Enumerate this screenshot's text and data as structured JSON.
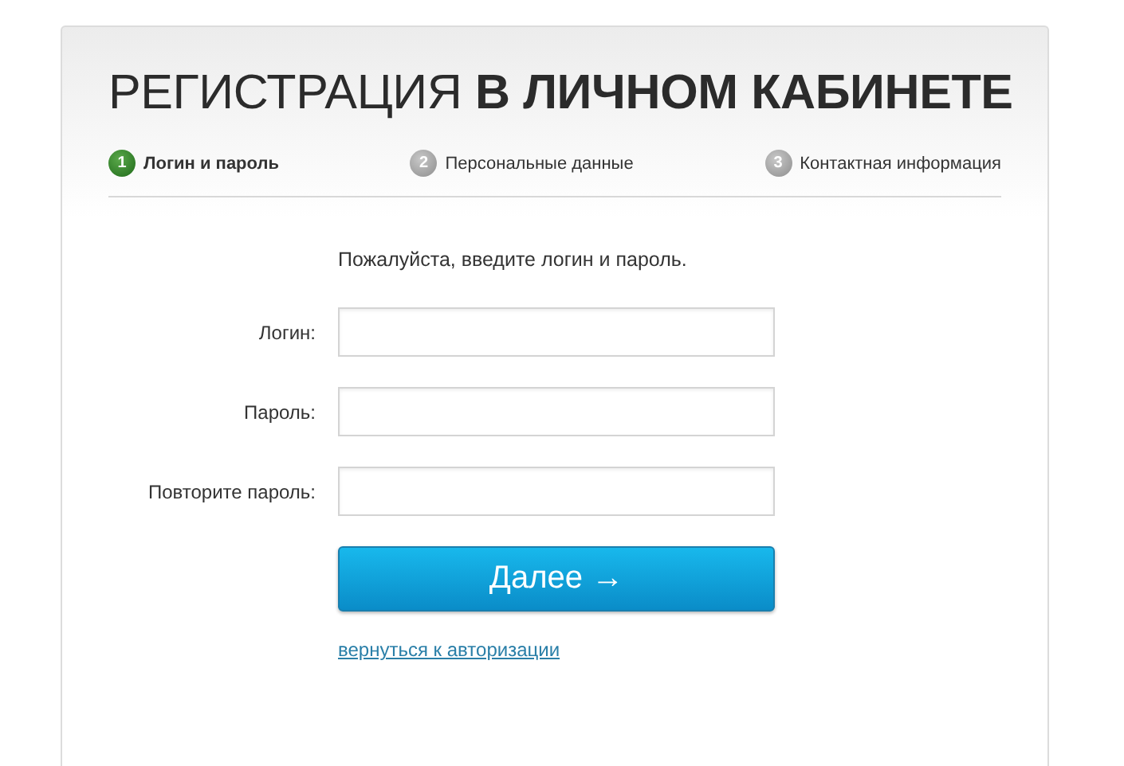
{
  "title": "РЕГИСТРАЦИЯ **В ЛИЧНОМ КАБИНЕТЕ**",
  "steps": [
    {
      "number": "1",
      "label": "Логин и пароль",
      "selected": true
    },
    {
      "number": "2",
      "label": "Персональные данные",
      "selected": false
    },
    {
      "number": "3",
      "label": "Контактная информация",
      "selected": false
    }
  ],
  "instruction": "Пожалуйста, введите логин и пароль.",
  "fields": [
    {
      "label": "Логин:"
    },
    {
      "label": "Пароль:"
    },
    {
      "label": "Повторите пароль:"
    }
  ],
  "submit_button": "Далее →",
  "back_link": "вернуться к авторизации"
}
